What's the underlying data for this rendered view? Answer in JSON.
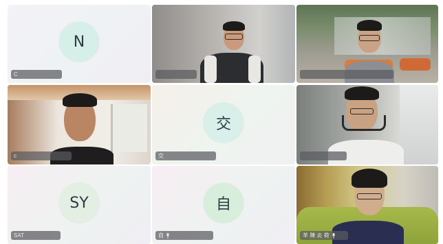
{
  "tiles": [
    {
      "kind": "avatar",
      "initial": "N",
      "name_label": "C",
      "avatar_color": "#d6efe8"
    },
    {
      "kind": "video",
      "name_label": ""
    },
    {
      "kind": "video",
      "name_label": ""
    },
    {
      "kind": "video",
      "name_label": "c"
    },
    {
      "kind": "avatar",
      "initial": "交",
      "name_label": "交",
      "avatar_color": "#d8efea"
    },
    {
      "kind": "video",
      "name_label": ""
    },
    {
      "kind": "avatar",
      "initial": "SY",
      "name_label": "SAT",
      "avatar_color": "#e4efe4"
    },
    {
      "kind": "avatar",
      "initial": "自",
      "name_label": "自",
      "avatar_color": "#d7eedc"
    },
    {
      "kind": "video",
      "name_label": "羊 陳 炎 荷"
    }
  ],
  "colors": {
    "name_pill_bg": "#5a5a5f",
    "avatar_text": "#2f3b44"
  },
  "icons": [
    "mic-icon"
  ]
}
